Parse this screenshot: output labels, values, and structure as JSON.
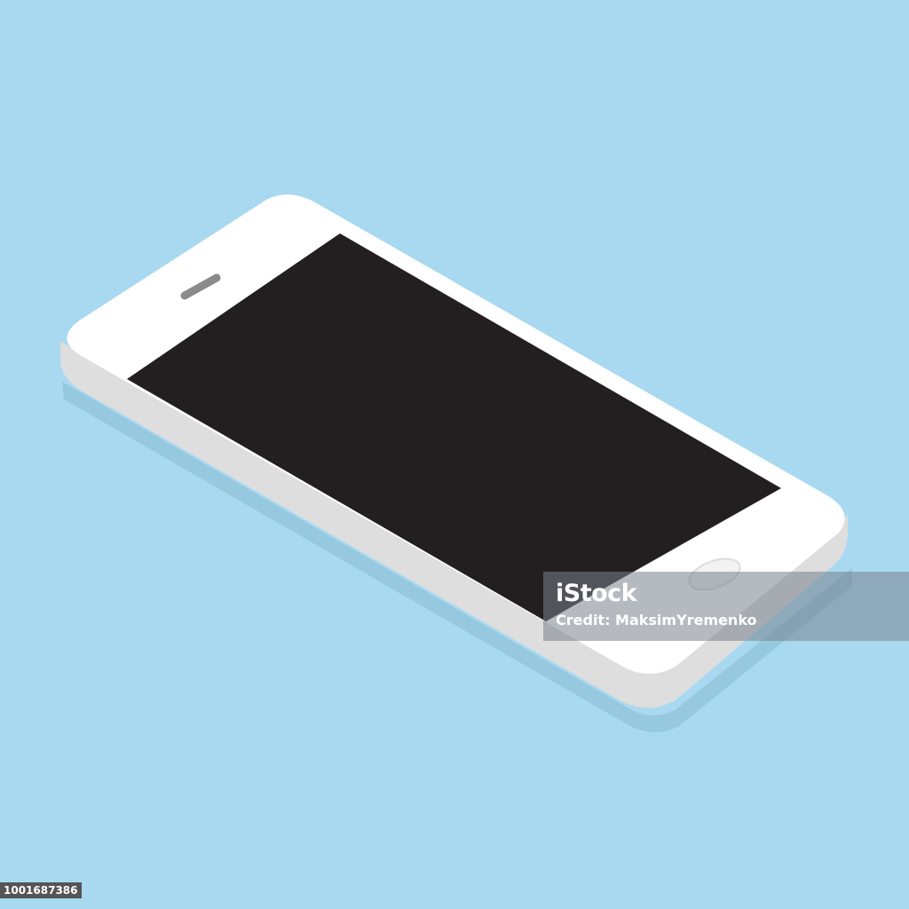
{
  "colors": {
    "background": "#a8d9f0",
    "phone_body": "#ffffff",
    "phone_edge": "#dcdcdc",
    "screen": "#231f20",
    "speaker": "#8a8a8a"
  },
  "watermark": {
    "brand": "iStock",
    "credit": "Credit: MaksimYremenko"
  },
  "stock_id": "1001687386",
  "icons": {
    "phone": "smartphone-icon",
    "speaker": "speaker-grille-icon",
    "home_button": "home-button-icon"
  }
}
